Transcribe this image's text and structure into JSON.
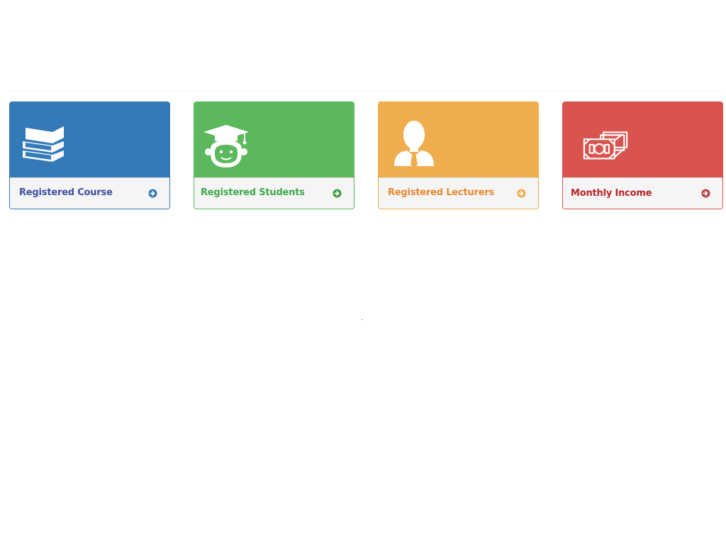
{
  "cards": [
    {
      "label": "Registered Course",
      "icon": "books-icon",
      "color": "#337ab7",
      "text_color": "#3c4fa3"
    },
    {
      "label": "Registered Students",
      "icon": "graduate-student-icon",
      "color": "#5cb85c",
      "text_color": "#3ea84a"
    },
    {
      "label": "Registered Lecturers",
      "icon": "lecturer-person-icon",
      "color": "#f0ad4e",
      "text_color": "#e8892e"
    },
    {
      "label": "Monthly Income",
      "icon": "money-stack-icon",
      "color": "#d9534f",
      "text_color": "#b8232a"
    }
  ]
}
